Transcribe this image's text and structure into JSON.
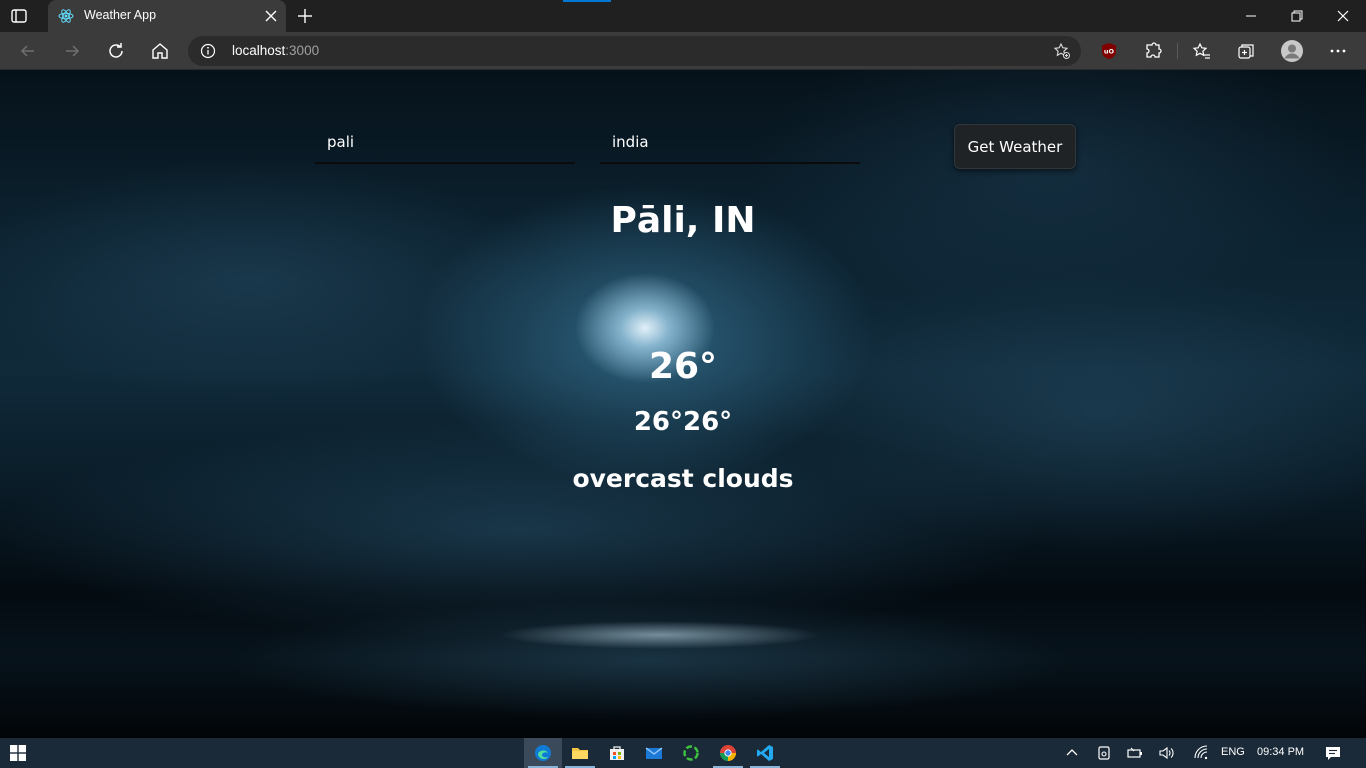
{
  "browser": {
    "tab_title": "Weather App",
    "url_host": "localhost",
    "url_port": ":3000"
  },
  "form": {
    "city_value": "pali",
    "country_value": "india",
    "submit_label": "Get Weather"
  },
  "weather": {
    "location": "Pāli, IN",
    "temperature": "26°",
    "min_max": "26°26°",
    "description": "overcast clouds"
  },
  "taskbar": {
    "language": "ENG",
    "time": "09:34 PM"
  }
}
